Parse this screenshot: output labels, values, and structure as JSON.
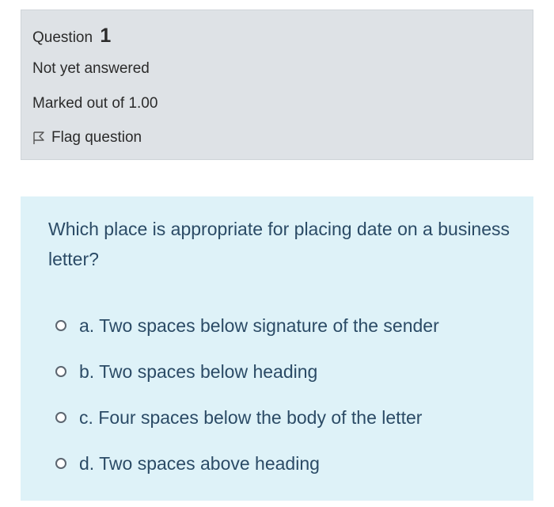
{
  "info": {
    "question_label": "Question",
    "question_number": "1",
    "state": "Not yet answered",
    "grade": "Marked out of 1.00",
    "flag_label": "Flag question"
  },
  "question": {
    "text": "Which place is appropriate for placing date on a business letter?",
    "answers": [
      {
        "label": "a. Two spaces below signature of the sender"
      },
      {
        "label": "b. Two spaces below heading"
      },
      {
        "label": "c. Four spaces below the body of the letter"
      },
      {
        "label": "d. Two spaces above heading"
      }
    ]
  },
  "colors": {
    "info_background": "#dee2e6",
    "content_background": "#def2f8",
    "question_text": "#2b4b66"
  },
  "icons": {
    "flag": "flag-icon",
    "radio": "radio-button"
  }
}
